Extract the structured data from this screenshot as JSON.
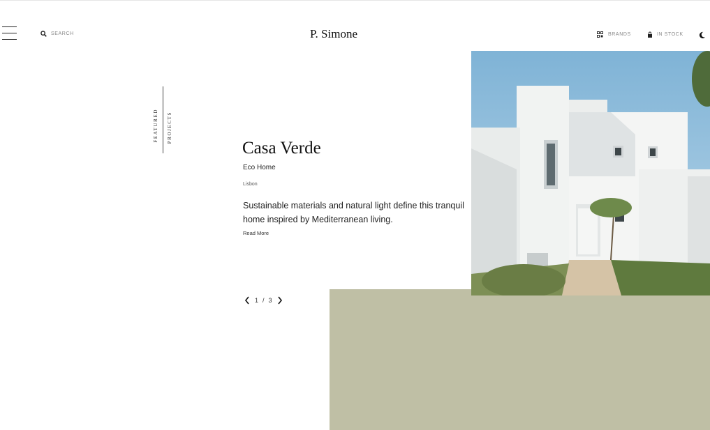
{
  "header": {
    "search_label": "SEARCH",
    "brand": "P. Simone",
    "brands_label": "BRANDS",
    "in_stock_label": "IN STOCK"
  },
  "section_label": {
    "line1": "FEATURED",
    "line2": "PROJECTS"
  },
  "project": {
    "title": "Casa Verde",
    "subtitle": "Eco Home",
    "location": "Lisbon",
    "description": "Sustainable materials and natural light define this tranquil home inspired by Mediterranean living.",
    "read_more": "Read More"
  },
  "pagination": {
    "current": "1",
    "separator": "/",
    "total": "3"
  },
  "colors": {
    "olive_block": "#bfbfa5",
    "sky": "#8fbcd9",
    "text": "#1a1a1a"
  },
  "icons": [
    "menu-icon",
    "search-icon",
    "grid-icon",
    "lock-icon",
    "moon-icon",
    "chevron-left-icon",
    "chevron-right-icon"
  ]
}
